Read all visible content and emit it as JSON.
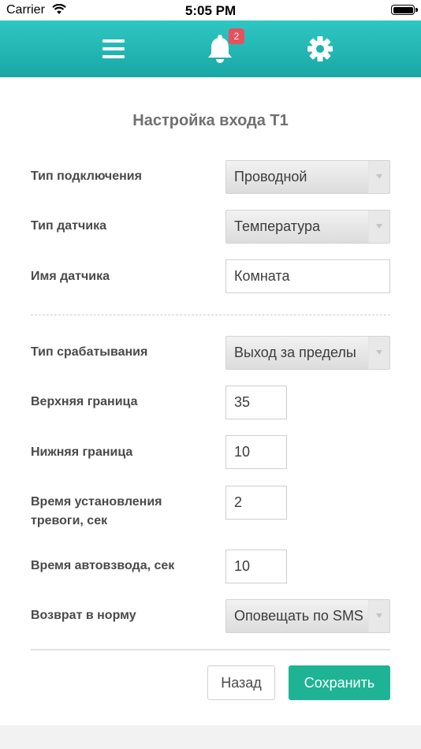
{
  "status_bar": {
    "carrier": "Carrier",
    "time": "5:05 PM"
  },
  "toolbar": {
    "notifications_count": "2"
  },
  "page": {
    "title": "Настройка входа Т1"
  },
  "form": {
    "connection_type": {
      "label": "Тип подключения",
      "value": "Проводной"
    },
    "sensor_type": {
      "label": "Тип датчика",
      "value": "Температура"
    },
    "sensor_name": {
      "label": "Имя датчика",
      "value": "Комната"
    },
    "trigger_type": {
      "label": "Тип срабатывания",
      "value": "Выход за пределы"
    },
    "upper_limit": {
      "label": "Верхняя граница",
      "value": "35"
    },
    "lower_limit": {
      "label": "Нижняя граница",
      "value": "10"
    },
    "alarm_time": {
      "label": "Время установления тревоги, сек",
      "value": "2"
    },
    "auto_arm_time": {
      "label": "Время автовзвода, сек",
      "value": "10"
    },
    "return_to_normal": {
      "label": "Возврат в норму",
      "value": "Оповещать по SMS"
    }
  },
  "buttons": {
    "back": "Назад",
    "save": "Сохранить"
  },
  "colors": {
    "toolbar_top": "#2ec7c3",
    "toolbar_bottom": "#1aa7a4",
    "save_button": "#1eb394",
    "badge": "#e8505b"
  },
  "icons": {
    "menu": "hamburger-menu-icon",
    "notifications": "bell-icon",
    "settings": "gear-icon"
  }
}
